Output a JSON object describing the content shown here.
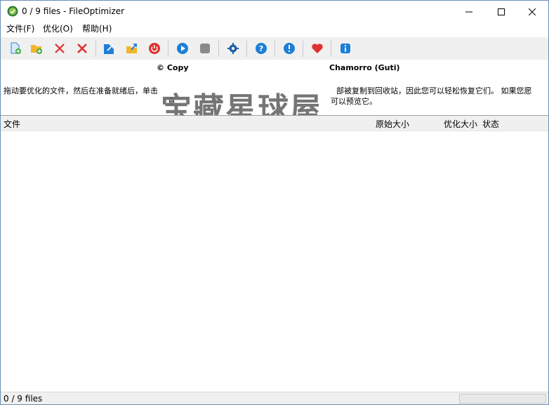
{
  "window": {
    "title": "0 / 9 files - FileOptimizer"
  },
  "menu": {
    "items": [
      {
        "label": "文件(F)"
      },
      {
        "label": "优化(O)"
      },
      {
        "label": "帮助(H)"
      }
    ]
  },
  "toolbar": {
    "buttons": [
      {
        "icon": "add-file-icon"
      },
      {
        "icon": "add-folder-icon"
      },
      {
        "icon": "remove-icon"
      },
      {
        "icon": "clear-icon"
      },
      {
        "icon": "export-icon"
      },
      {
        "icon": "open-folder-icon"
      },
      {
        "icon": "power-icon"
      },
      {
        "icon": "play-icon"
      },
      {
        "icon": "stop-icon"
      },
      {
        "icon": "gear-icon"
      },
      {
        "icon": "help-icon"
      },
      {
        "icon": "info-round-icon"
      },
      {
        "icon": "heart-icon"
      },
      {
        "icon": "info-icon"
      }
    ]
  },
  "info": {
    "copyright_left": "© Copy",
    "copyright_right": "Chamorro (Guti)",
    "hint_1": "拖动要优化的文件，然后在准备就绪后，单击",
    "hint_2": "部被复制到回收站，因此您可以轻松恢复它们。 如果您愿",
    "hint_3": "意",
    "hint_4": "可以预览它。",
    "watermark": "宝藏星球屋"
  },
  "list": {
    "columns": [
      {
        "label": "文件"
      },
      {
        "label": "原始大小"
      },
      {
        "label": "优化大小"
      },
      {
        "label": "状态"
      }
    ]
  },
  "status": {
    "text": "0 / 9 files"
  },
  "colors": {
    "blue": "#1e7fd6",
    "red": "#e03030",
    "yellow": "#f2b52a",
    "gray_icon": "#6b6b6b"
  }
}
